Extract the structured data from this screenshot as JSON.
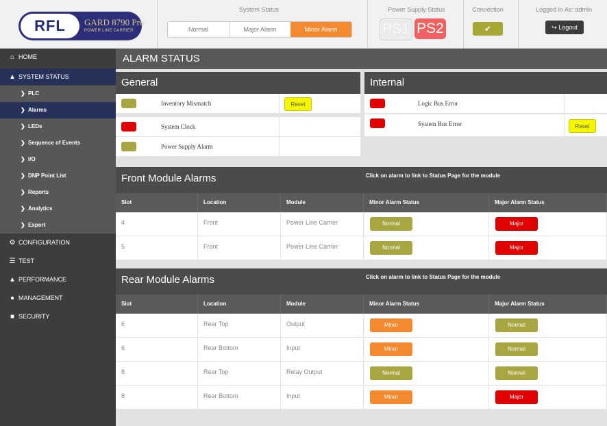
{
  "header": {
    "logo": {
      "brand": "RFL",
      "product": "GARD 8790 Pro",
      "subtitle": "POWER LINE CARRIER"
    },
    "system_status": {
      "label": "System Status",
      "options": [
        "Normal",
        "Major Alarm",
        "Minor Alarm"
      ],
      "selected": "Minor Alarm"
    },
    "power_supply": {
      "label": "Power Supply Status",
      "ps1": "PS1",
      "ps2": "PS2"
    },
    "connection": {
      "label": "Connection",
      "state_icon": "checkmark-icon"
    },
    "user": {
      "label": "Logged In As: admin",
      "logout_label": "Logout"
    }
  },
  "sidebar": {
    "items": [
      {
        "label": "HOME",
        "icon": "home-icon"
      },
      {
        "label": "SYSTEM STATUS",
        "icon": "bell-icon",
        "active": true
      },
      {
        "label": "CONFIGURATION",
        "icon": "gear-icon"
      },
      {
        "label": "TEST",
        "icon": "test-icon"
      },
      {
        "label": "PERFORMANCE",
        "icon": "performance-icon"
      },
      {
        "label": "MANAGEMENT",
        "icon": "user-icon"
      },
      {
        "label": "SECURITY",
        "icon": "lock-icon"
      }
    ],
    "subitems": [
      "PLC",
      "Alarms",
      "LEDs",
      "Sequence of Events",
      "I/O",
      "DNP Point List",
      "Reports",
      "Analytics",
      "Export"
    ],
    "active_subitem": "Alarms"
  },
  "main": {
    "title": "ALARM STATUS",
    "general": {
      "title": "General",
      "rows": [
        {
          "label": "Inventory Mismatch",
          "color": "olive",
          "reset": "Reset"
        },
        {
          "label": "System Clock",
          "color": "red",
          "reset": ""
        },
        {
          "label": "Power Supply Alarm",
          "color": "olive",
          "reset": ""
        }
      ]
    },
    "internal": {
      "title": "Internal",
      "rows": [
        {
          "label": "Logic Bus Error",
          "color": "red",
          "reset": ""
        },
        {
          "label": "System Bus Error",
          "color": "red",
          "reset": "Reset"
        }
      ]
    },
    "front_modules": {
      "title": "Front Module Alarms",
      "hint": "Click on alarm to link to Status Page for the module",
      "columns": [
        "Slot",
        "Location",
        "Module",
        "Minor Alarm Status",
        "Major Alarm Status"
      ],
      "rows": [
        {
          "slot": "4",
          "location": "Front",
          "module": "Power Line Carrier",
          "minor": "Normal",
          "major": "Major"
        },
        {
          "slot": "5",
          "location": "Front",
          "module": "Power Line Carrier",
          "minor": "Normal",
          "major": "Major"
        }
      ]
    },
    "rear_modules": {
      "title": "Rear Module Alarms",
      "hint": "Click on alarm to link to Status Page for the module",
      "columns": [
        "Slot",
        "Location",
        "Module",
        "Minor Alarm Status",
        "Major Alarm Status"
      ],
      "rows": [
        {
          "slot": "6",
          "location": "Rear Top",
          "module": "Output",
          "minor": "Minor",
          "major": "Normal"
        },
        {
          "slot": "6",
          "location": "Rear Bottom",
          "module": "Input",
          "minor": "Minor",
          "major": "Normal"
        },
        {
          "slot": "8",
          "location": "Rear Top",
          "module": "Relay Output",
          "minor": "Normal",
          "major": "Normal"
        },
        {
          "slot": "8",
          "location": "Rear Bottom",
          "module": "Input",
          "minor": "Minor",
          "major": "Major"
        }
      ]
    }
  },
  "colors": {
    "normal": "#a7a640",
    "major": "#e00000",
    "minor": "#f48a2f",
    "nav_active": "#27325a",
    "reset": "#f5f500"
  }
}
